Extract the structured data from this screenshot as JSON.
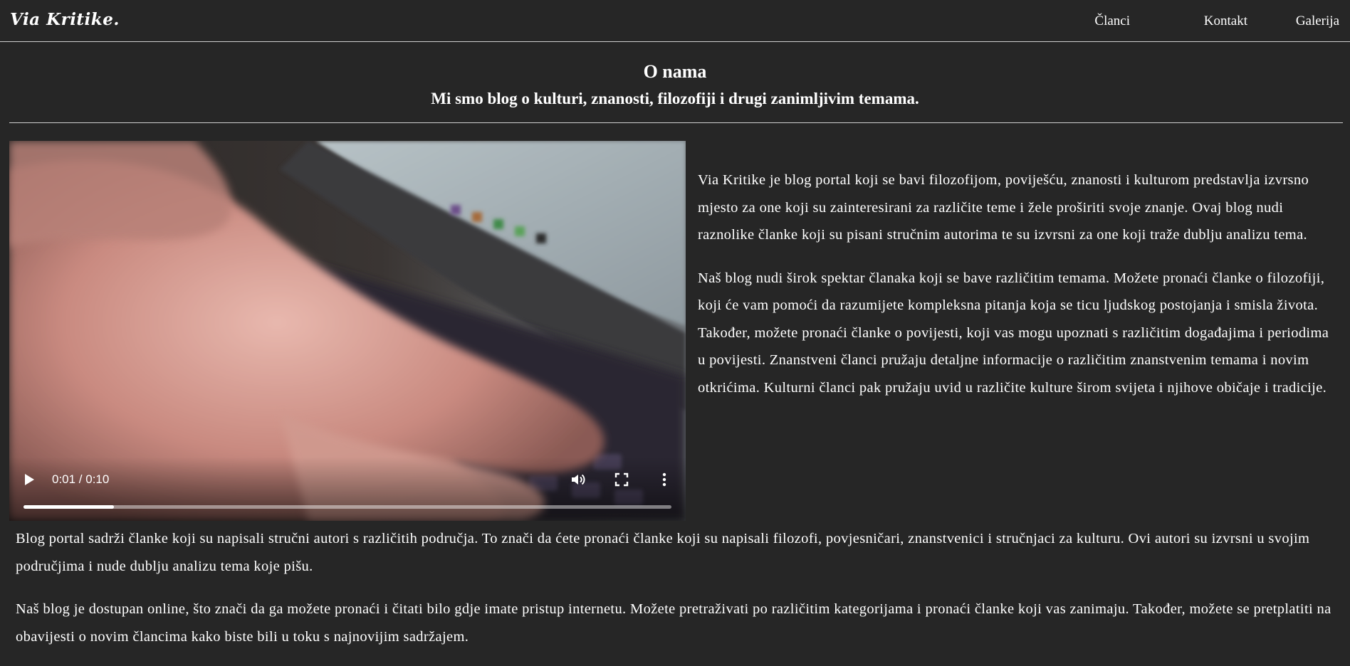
{
  "navbar": {
    "logo": "Via Kritike.",
    "links": [
      "Članci",
      "Kontakt",
      "Galerija"
    ]
  },
  "header": {
    "title": "O nama",
    "subtitle": "Mi smo blog o kulturi, znanosti, filozofiji i drugi zanimljivim temama."
  },
  "video": {
    "time": "0:01 / 0:10",
    "progress": 0.14,
    "icons": [
      "play-icon",
      "volume-icon",
      "fullscreen-icon",
      "more-options-icon"
    ]
  },
  "content": {
    "side_paragraphs": [
      "Via Kritike je blog portal koji se bavi filozofijom, poviješću, znanosti i kulturom predstavlja izvrsno mjesto za one koji su zainteresirani za različite teme i žele proširiti svoje znanje. Ovaj blog nudi raznolike članke koji su pisani stručnim autorima te su izvrsni za one koji traže dublju analizu tema.",
      "Naš blog nudi širok spektar članaka koji se bave različitim temama. Možete pronaći članke o filozofiji, koji će vam pomoći da razumijete kompleksna pitanja koja se ticu ljudskog postojanja i smisla života. Također, možete pronaći članke o povijesti, koji vas mogu upoznati s različitim događajima i periodima u povijesti. Znanstveni članci pružaju detaljne informacije o različitim znanstvenim temama i novim otkrićima. Kulturni članci pak pružaju uvid u različite kulture širom svijeta i njihove običaje i tradicije."
    ],
    "bottom_paragraphs": [
      "Blog portal sadrži članke koji su napisali stručni autori s različitih područja. To znači da ćete pronaći članke koji su napisali filozofi, povjesničari, znanstvenici i stručnjaci za kulturu. Ovi autori su izvrsni u svojim područjima i nude dublju analizu tema koje pišu.",
      "Naš blog je dostupan online, što znači da ga možete pronaći i čitati bilo gdje imate pristup internetu. Možete pretraživati po različitim kategorijama i pronaći članke koji vas zanimaju. Također, možete se pretplatiti na obavijesti o novim člancima kako biste bili u toku s najnovijim sadržajem."
    ]
  },
  "colors": {
    "background": "#262626",
    "text": "#ffffff",
    "divider": "#cfcfcf"
  }
}
